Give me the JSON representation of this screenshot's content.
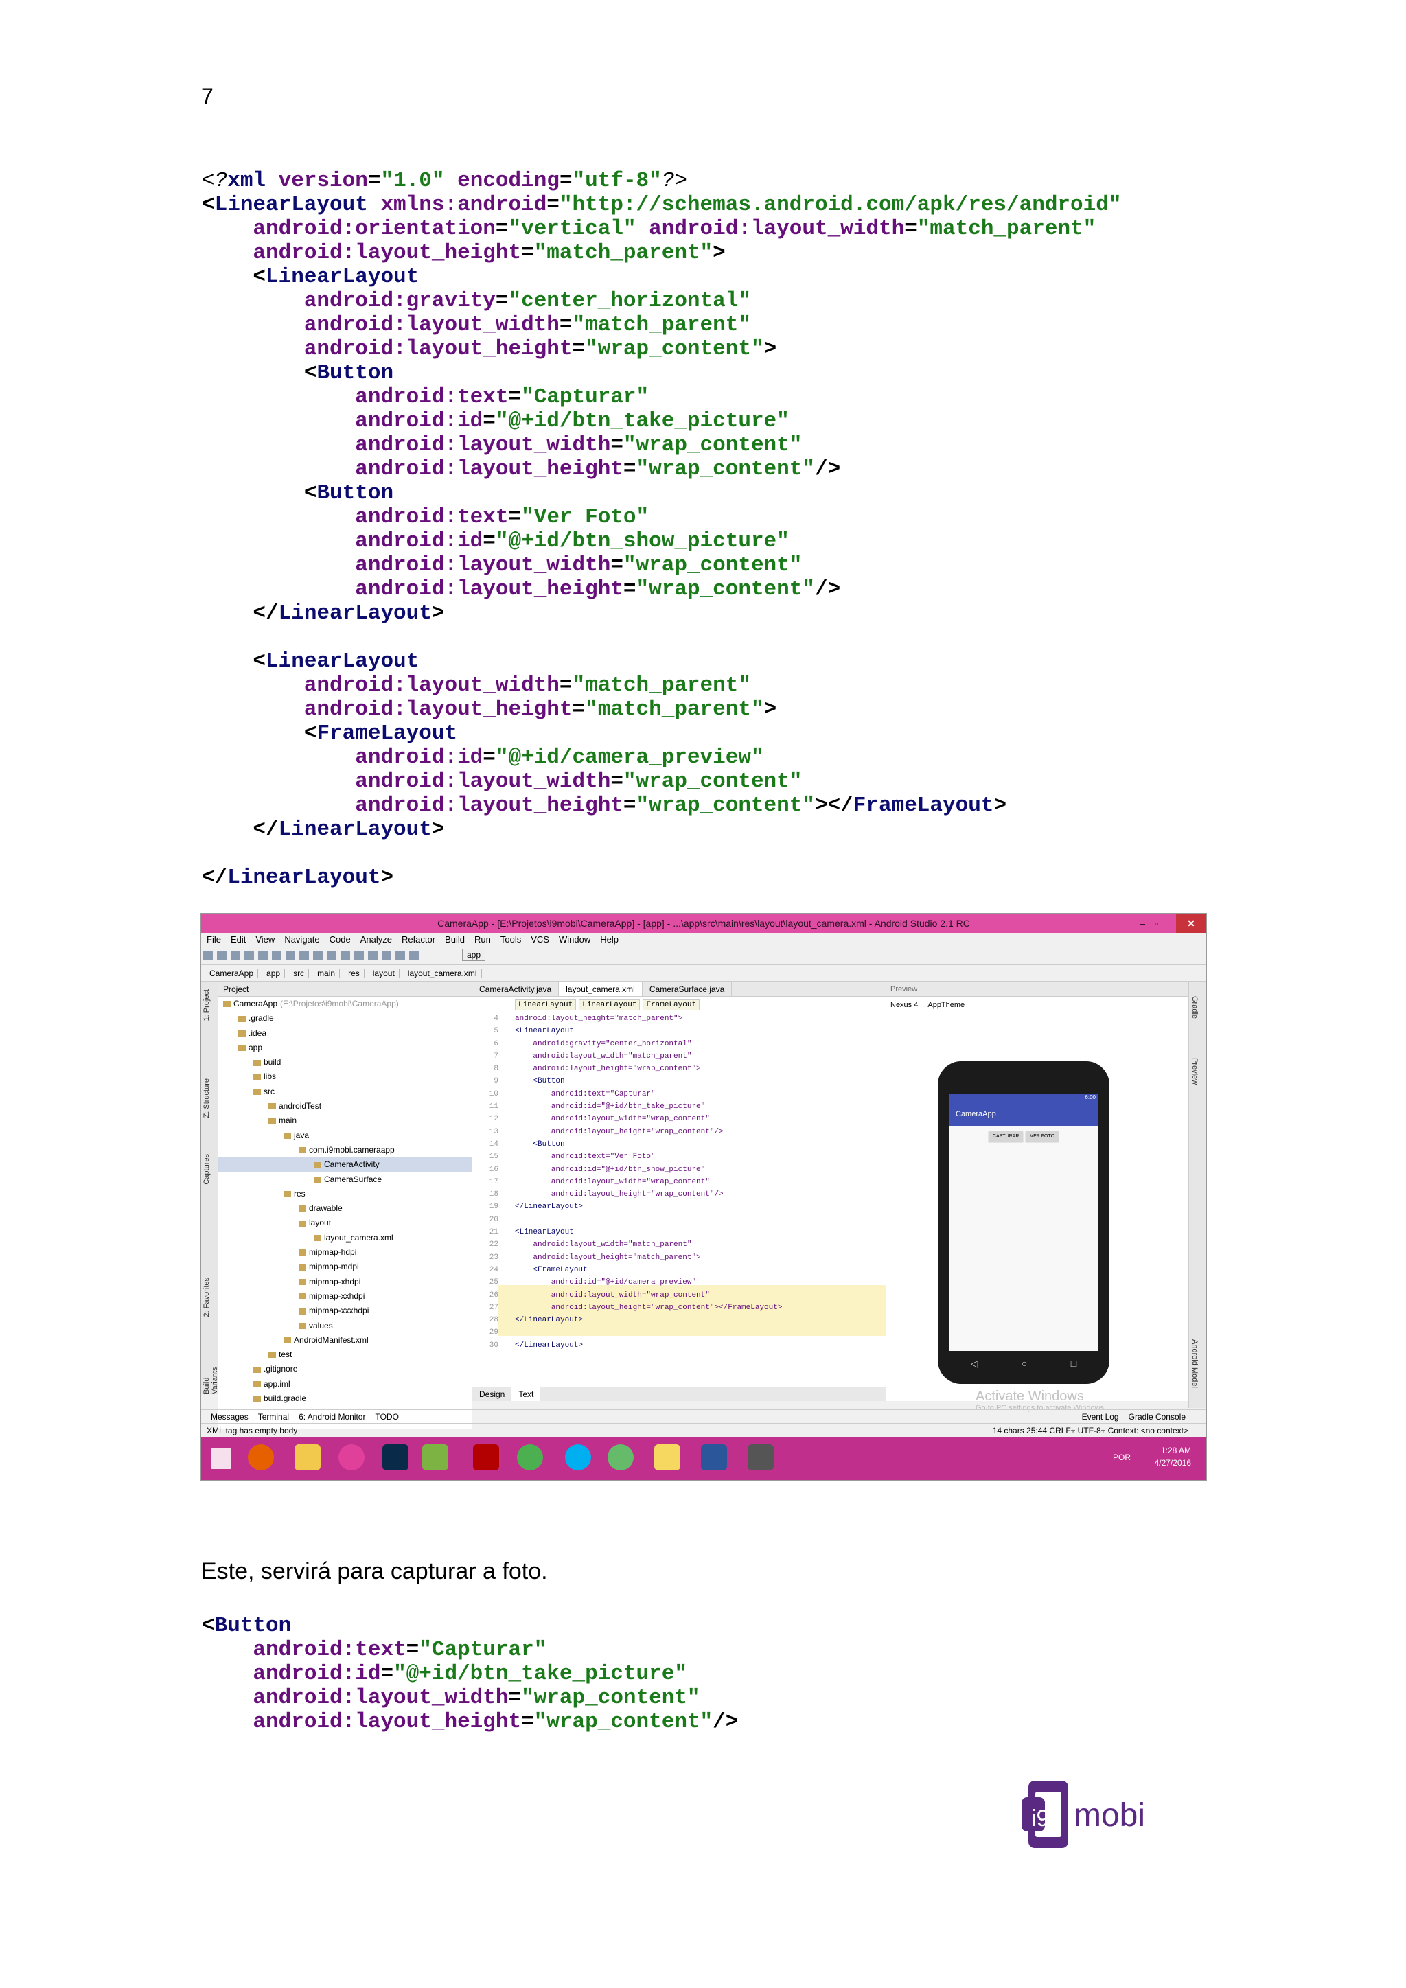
{
  "page_number": "7",
  "code_block_1": [
    [
      [
        "i",
        "<?"
      ],
      [
        "n",
        "xml "
      ],
      [
        "a",
        "version"
      ],
      [
        "t",
        "="
      ],
      [
        "v",
        "\"1.0\""
      ],
      [
        "t",
        " "
      ],
      [
        "a",
        "encoding"
      ],
      [
        "t",
        "="
      ],
      [
        "v",
        "\"utf-8\""
      ],
      [
        "i",
        "?>"
      ]
    ],
    [
      [
        "t",
        "<"
      ],
      [
        "n",
        "LinearLayout "
      ],
      [
        "a",
        "xmlns:android"
      ],
      [
        "t",
        "="
      ],
      [
        "v",
        "\"http://schemas.android.com/apk/res/android\""
      ]
    ],
    [
      [
        "t",
        "    "
      ],
      [
        "a",
        "android:orientation"
      ],
      [
        "t",
        "="
      ],
      [
        "v",
        "\"vertical\""
      ],
      [
        "t",
        " "
      ],
      [
        "a",
        "android:layout_width"
      ],
      [
        "t",
        "="
      ],
      [
        "v",
        "\"match_parent\""
      ]
    ],
    [
      [
        "t",
        "    "
      ],
      [
        "a",
        "android:layout_height"
      ],
      [
        "t",
        "="
      ],
      [
        "v",
        "\"match_parent\""
      ],
      [
        "t",
        ">"
      ]
    ],
    [
      [
        "t",
        "    <"
      ],
      [
        "n",
        "LinearLayout"
      ]
    ],
    [
      [
        "t",
        "        "
      ],
      [
        "a",
        "android:gravity"
      ],
      [
        "t",
        "="
      ],
      [
        "v",
        "\"center_horizontal\""
      ]
    ],
    [
      [
        "t",
        "        "
      ],
      [
        "a",
        "android:layout_width"
      ],
      [
        "t",
        "="
      ],
      [
        "v",
        "\"match_parent\""
      ]
    ],
    [
      [
        "t",
        "        "
      ],
      [
        "a",
        "android:layout_height"
      ],
      [
        "t",
        "="
      ],
      [
        "v",
        "\"wrap_content\""
      ],
      [
        "t",
        ">"
      ]
    ],
    [
      [
        "t",
        "        <"
      ],
      [
        "n",
        "Button"
      ]
    ],
    [
      [
        "t",
        "            "
      ],
      [
        "a",
        "android:text"
      ],
      [
        "t",
        "="
      ],
      [
        "v",
        "\"Capturar\""
      ]
    ],
    [
      [
        "t",
        "            "
      ],
      [
        "a",
        "android:id"
      ],
      [
        "t",
        "="
      ],
      [
        "v",
        "\"@+id/btn_take_picture\""
      ]
    ],
    [
      [
        "t",
        "            "
      ],
      [
        "a",
        "android:layout_width"
      ],
      [
        "t",
        "="
      ],
      [
        "v",
        "\"wrap_content\""
      ]
    ],
    [
      [
        "t",
        "            "
      ],
      [
        "a",
        "android:layout_height"
      ],
      [
        "t",
        "="
      ],
      [
        "v",
        "\"wrap_content\""
      ],
      [
        "t",
        "/>"
      ]
    ],
    [
      [
        "t",
        "        <"
      ],
      [
        "n",
        "Button"
      ]
    ],
    [
      [
        "t",
        "            "
      ],
      [
        "a",
        "android:text"
      ],
      [
        "t",
        "="
      ],
      [
        "v",
        "\"Ver Foto\""
      ]
    ],
    [
      [
        "t",
        "            "
      ],
      [
        "a",
        "android:id"
      ],
      [
        "t",
        "="
      ],
      [
        "v",
        "\"@+id/btn_show_picture\""
      ]
    ],
    [
      [
        "t",
        "            "
      ],
      [
        "a",
        "android:layout_width"
      ],
      [
        "t",
        "="
      ],
      [
        "v",
        "\"wrap_content\""
      ]
    ],
    [
      [
        "t",
        "            "
      ],
      [
        "a",
        "android:layout_height"
      ],
      [
        "t",
        "="
      ],
      [
        "v",
        "\"wrap_content\""
      ],
      [
        "t",
        "/>"
      ]
    ],
    [
      [
        "t",
        "    </"
      ],
      [
        "n",
        "LinearLayout"
      ],
      [
        "t",
        ">"
      ]
    ],
    [
      [
        "t",
        ""
      ]
    ],
    [
      [
        "t",
        "    <"
      ],
      [
        "n",
        "LinearLayout"
      ]
    ],
    [
      [
        "t",
        "        "
      ],
      [
        "a",
        "android:layout_width"
      ],
      [
        "t",
        "="
      ],
      [
        "v",
        "\"match_parent\""
      ]
    ],
    [
      [
        "t",
        "        "
      ],
      [
        "a",
        "android:layout_height"
      ],
      [
        "t",
        "="
      ],
      [
        "v",
        "\"match_parent\""
      ],
      [
        "t",
        ">"
      ]
    ],
    [
      [
        "t",
        "        <"
      ],
      [
        "n",
        "FrameLayout"
      ]
    ],
    [
      [
        "t",
        "            "
      ],
      [
        "a",
        "android:id"
      ],
      [
        "t",
        "="
      ],
      [
        "v",
        "\"@+id/camera_preview\""
      ]
    ],
    [
      [
        "t",
        "            "
      ],
      [
        "a",
        "android:layout_width"
      ],
      [
        "t",
        "="
      ],
      [
        "v",
        "\"wrap_content\""
      ]
    ],
    [
      [
        "t",
        "            "
      ],
      [
        "a",
        "android:layout_height"
      ],
      [
        "t",
        "="
      ],
      [
        "v",
        "\"wrap_content\""
      ],
      [
        "t",
        "></"
      ],
      [
        "n",
        "FrameLayout"
      ],
      [
        "t",
        ">"
      ]
    ],
    [
      [
        "t",
        "    </"
      ],
      [
        "n",
        "LinearLayout"
      ],
      [
        "t",
        ">"
      ]
    ],
    [
      [
        "t",
        ""
      ]
    ],
    [
      [
        "t",
        "</"
      ],
      [
        "n",
        "LinearLayout"
      ],
      [
        "t",
        ">"
      ]
    ]
  ],
  "ide": {
    "title": "CameraApp - [E:\\Projetos\\i9mobi\\CameraApp] - [app] - ...\\app\\src\\main\\res\\layout\\layout_camera.xml - Android Studio 2.1 RC",
    "menu": [
      "File",
      "Edit",
      "View",
      "Navigate",
      "Code",
      "Analyze",
      "Refactor",
      "Build",
      "Run",
      "Tools",
      "VCS",
      "Window",
      "Help"
    ],
    "run_config": "app",
    "breadcrumb": [
      "CameraApp",
      "app",
      "src",
      "main",
      "res",
      "layout",
      "layout_camera.xml"
    ],
    "project_header": "Project",
    "tree": [
      {
        "label": "CameraApp",
        "note": "(E:\\Projetos\\i9mobi\\CameraApp)",
        "d": 0
      },
      {
        "label": ".gradle",
        "d": 1
      },
      {
        "label": ".idea",
        "d": 1
      },
      {
        "label": "app",
        "d": 1
      },
      {
        "label": "build",
        "d": 2
      },
      {
        "label": "libs",
        "d": 2
      },
      {
        "label": "src",
        "d": 2
      },
      {
        "label": "androidTest",
        "d": 3
      },
      {
        "label": "main",
        "d": 3
      },
      {
        "label": "java",
        "d": 4
      },
      {
        "label": "com.i9mobi.cameraapp",
        "d": 5
      },
      {
        "label": "CameraActivity",
        "d": 6,
        "sel": true
      },
      {
        "label": "CameraSurface",
        "d": 6
      },
      {
        "label": "res",
        "d": 4
      },
      {
        "label": "drawable",
        "d": 5
      },
      {
        "label": "layout",
        "d": 5
      },
      {
        "label": "layout_camera.xml",
        "d": 6
      },
      {
        "label": "mipmap-hdpi",
        "d": 5
      },
      {
        "label": "mipmap-mdpi",
        "d": 5
      },
      {
        "label": "mipmap-xhdpi",
        "d": 5
      },
      {
        "label": "mipmap-xxhdpi",
        "d": 5
      },
      {
        "label": "mipmap-xxxhdpi",
        "d": 5
      },
      {
        "label": "values",
        "d": 5
      },
      {
        "label": "AndroidManifest.xml",
        "d": 4
      },
      {
        "label": "test",
        "d": 3
      },
      {
        "label": ".gitignore",
        "d": 2
      },
      {
        "label": "app.iml",
        "d": 2
      },
      {
        "label": "build.gradle",
        "d": 2
      }
    ],
    "left_tool_tabs": [
      "1: Project",
      "Z: Structure",
      "Captures",
      "2: Favorites",
      "Build Variants"
    ],
    "right_tool_tabs": [
      "Gradle",
      "Preview",
      "Android Model"
    ],
    "editor_tabs": [
      "CameraActivity.java",
      "layout_camera.xml",
      "CameraSurface.java"
    ],
    "xml_breadcrumb": [
      "LinearLayout",
      "LinearLayout",
      "FrameLayout"
    ],
    "line_numbers": [
      "4",
      "5",
      "6",
      "7",
      "8",
      "9",
      "10",
      "11",
      "12",
      "13",
      "14",
      "15",
      "16",
      "17",
      "18",
      "19",
      "20",
      "21",
      "22",
      "23",
      "24",
      "25",
      "26",
      "27",
      "28",
      "29",
      "30"
    ],
    "source_lines": [
      "android:layout_height=\"match_parent\">",
      "<LinearLayout",
      "    android:gravity=\"center_horizontal\"",
      "    android:layout_width=\"match_parent\"",
      "    android:layout_height=\"wrap_content\">",
      "    <Button",
      "        android:text=\"Capturar\"",
      "        android:id=\"@+id/btn_take_picture\"",
      "        android:layout_width=\"wrap_content\"",
      "        android:layout_height=\"wrap_content\"/>",
      "    <Button",
      "        android:text=\"Ver Foto\"",
      "        android:id=\"@+id/btn_show_picture\"",
      "        android:layout_width=\"wrap_content\"",
      "        android:layout_height=\"wrap_content\"/>",
      "</LinearLayout>",
      "",
      "<LinearLayout",
      "    android:layout_width=\"match_parent\"",
      "    android:layout_height=\"match_parent\">",
      "    <FrameLayout",
      "        android:id=\"@+id/camera_preview\"",
      "        android:layout_width=\"wrap_content\"",
      "        android:layout_height=\"wrap_content\"></FrameLayout>",
      "</LinearLayout>",
      "",
      "</LinearLayout>"
    ],
    "editor_bottom_tabs": [
      "Design",
      "Text"
    ],
    "preview_header": "Preview",
    "preview_toolbar": [
      "Nexus 4",
      "AppTheme"
    ],
    "phone_time": "6:00",
    "phone_app_title": "CameraApp",
    "phone_buttons": [
      "CAPTURAR",
      "VER FOTO"
    ],
    "phone_nav": [
      "◁",
      "○",
      "□"
    ],
    "watermark_title": "Activate Windows",
    "watermark_sub": "Go to PC settings to activate Windows.",
    "bottom_tools": [
      "Messages",
      "Terminal",
      "6: Android Monitor",
      "TODO"
    ],
    "bottom_tools_right": [
      "Event Log",
      "Gradle Console"
    ],
    "status_left": "XML tag has empty body",
    "status_right": "14 chars   25:44  CRLF÷  UTF-8÷  Context: <no context>",
    "taskbar_lang": "POR",
    "clock_time": "1:28 AM",
    "clock_date": "4/27/2016"
  },
  "paragraph": "Este, servirá para capturar a foto.",
  "code_block_2": [
    [
      [
        "t",
        "<"
      ],
      [
        "n",
        "Button"
      ]
    ],
    [
      [
        "t",
        "    "
      ],
      [
        "a",
        "android:text"
      ],
      [
        "t",
        "="
      ],
      [
        "v",
        "\"Capturar\""
      ]
    ],
    [
      [
        "t",
        "    "
      ],
      [
        "a",
        "android:id"
      ],
      [
        "t",
        "="
      ],
      [
        "v",
        "\"@+id/btn_take_picture\""
      ]
    ],
    [
      [
        "t",
        "    "
      ],
      [
        "a",
        "android:layout_width"
      ],
      [
        "t",
        "="
      ],
      [
        "v",
        "\"wrap_content\""
      ]
    ],
    [
      [
        "t",
        "    "
      ],
      [
        "a",
        "android:layout_height"
      ],
      [
        "t",
        "="
      ],
      [
        "v",
        "\"wrap_content\""
      ],
      [
        "t",
        "/>"
      ]
    ]
  ],
  "logo_text": "mobi",
  "colors": {
    "tag": "#0c0c6e",
    "attribute": "#660e7a",
    "value": "#1a7a1a",
    "titlebar": "#e04ea4",
    "taskbar": "#c12f8c",
    "logo": "#5a2a82"
  },
  "icons": [
    "windows-start-icon",
    "firefox-icon",
    "explorer-icon",
    "photoshop-icon",
    "android-studio-icon",
    "filezilla-icon",
    "chrome-icon",
    "skype-icon",
    "word-icon",
    "search-icon",
    "settings-icon"
  ]
}
